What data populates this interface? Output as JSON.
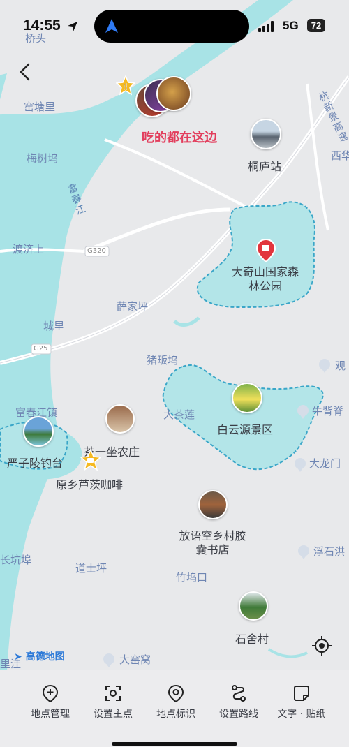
{
  "status": {
    "time": "14:55",
    "network": "5G",
    "battery": "72"
  },
  "map": {
    "labels": {
      "qiaotou": "桥头",
      "yaotangli": "窑塘里",
      "meishuwu": "梅树坞",
      "duji": "渡济上",
      "xuejiaping": "薛家坪",
      "chengli": "城里",
      "zhubanwu": "猪畈坞",
      "guan": "观",
      "fuchunjiang_town": "富春江镇",
      "dachalian": "大茶莲",
      "niubeijing": "牛背脊",
      "dalongmen": "大龙门",
      "fushihong": "浮石洪",
      "changkengbu": "长坑埠",
      "daoshiping": "道士坪",
      "zhuwukou": "竹坞口",
      "dayaowo": "大窑窝",
      "lizhu": "里洼",
      "xinan": "西华",
      "g320": "G320",
      "g25": "G25",
      "river_vertical": [
        "富",
        "春",
        "江"
      ],
      "expressway_vertical": [
        "杭",
        "新",
        "景",
        "高",
        "速"
      ]
    },
    "pois": {
      "food_cluster": "吃的都在这边",
      "tonglu_station": "桐庐站",
      "daqishan": "大奇山国家森林公园",
      "baiyunyuan": "白云源景区",
      "yanziling": "严子陵钓台",
      "chayizuo": "茶一坐农庄",
      "yuanxiang": "原乡芦茨咖啡",
      "fangyu": "放语空乡村胶囊书店",
      "shishecun": "石舍村"
    },
    "brand": "高德地图",
    "colors": {
      "water": "#a8e3e6",
      "park_fill": "#b3e5e8",
      "park_border": "#3aa6c8",
      "label_blue": "#6f86b3",
      "highlight": "#e23d5c"
    }
  },
  "toolbar": {
    "items": [
      {
        "label": "地点管理",
        "icon": "pin-add-icon"
      },
      {
        "label": "设置主点",
        "icon": "focus-point-icon"
      },
      {
        "label": "地点标识",
        "icon": "location-pin-icon"
      },
      {
        "label": "设置路线",
        "icon": "route-icon"
      },
      {
        "label": "文字 · 贴纸",
        "icon": "sticker-icon"
      }
    ]
  }
}
